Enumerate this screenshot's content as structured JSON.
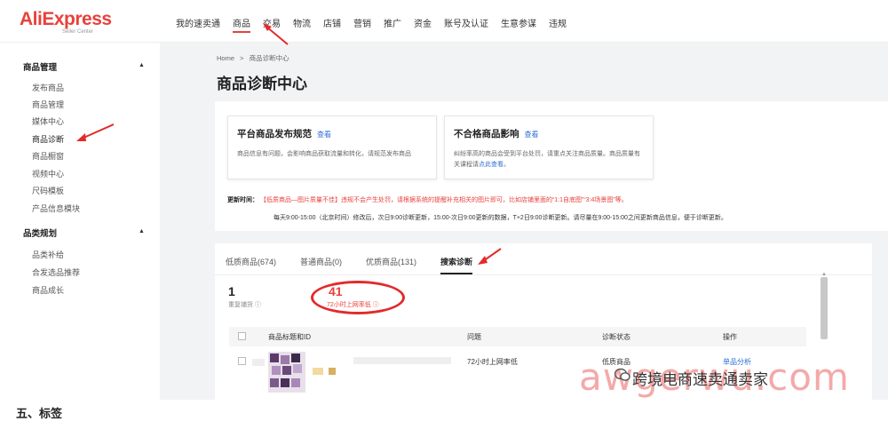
{
  "logo": {
    "brand": "AliExpress",
    "sub": "Seller Center"
  },
  "nav": [
    "我的速卖通",
    "商品",
    "交易",
    "物流",
    "店铺",
    "营销",
    "推广",
    "资金",
    "账号及认证",
    "生意参谋",
    "违规"
  ],
  "sidebar": {
    "group1": "商品管理",
    "group1_items": [
      "发布商品",
      "商品管理",
      "媒体中心",
      "商品诊断",
      "商品橱窗",
      "视频中心",
      "尺码模板",
      "产品信息模块"
    ],
    "group2": "品类规划",
    "group2_items": [
      "品类补给",
      "合发选品推荐",
      "商品成长"
    ]
  },
  "breadcrumb": {
    "home": "Home",
    "sep": ">",
    "current": "商品诊断中心"
  },
  "page_title": "商品诊断中心",
  "card1": {
    "title": "平台商品发布规范",
    "link": "查看",
    "desc": "商品信息有问题，会影响商品获取流量和转化，请规范发布商品"
  },
  "card2": {
    "title": "不合格商品影响",
    "link": "查看",
    "desc": "纠纷率高的商品会受到平台处罚，请重点关注商品质量。商品质量有关课程请",
    "desc_link": "点此查看",
    "desc_end": "。"
  },
  "update": {
    "label": "更新时间：",
    "red": "【低质商品—图片质量不佳】违规不会产生处罚，请根据系统的提醒补充相关的图片即可，比如店铺里面的“1:1自底图”“3:4场景图”等。",
    "line2": "每天9:00-15:00（北京时间）修改后，次日9:00诊断更新，15:00-次日9:00更新的数据，T+2日9:00诊断更新。请尽量在9:00-15:00之间更新商品信息，便于诊断更新。"
  },
  "tabs": [
    "低质商品(674)",
    "普通商品(0)",
    "优质商品(131)",
    "搜索诊断"
  ],
  "stats": [
    {
      "num": "1",
      "label": "重复铺货 ⓘ"
    },
    {
      "num": "41",
      "label": "72小时上网率低 ⓘ"
    }
  ],
  "table": {
    "headers": [
      "商品标题和ID",
      "问题",
      "诊断状态",
      "操作"
    ],
    "row": {
      "issue": "72小时上网率低",
      "status": "低质商品",
      "action": "单品分析"
    }
  },
  "watermark": {
    "text": "awgerwu.com",
    "cn": "跨境电商速卖通卖家"
  },
  "bottom": "五、标签"
}
